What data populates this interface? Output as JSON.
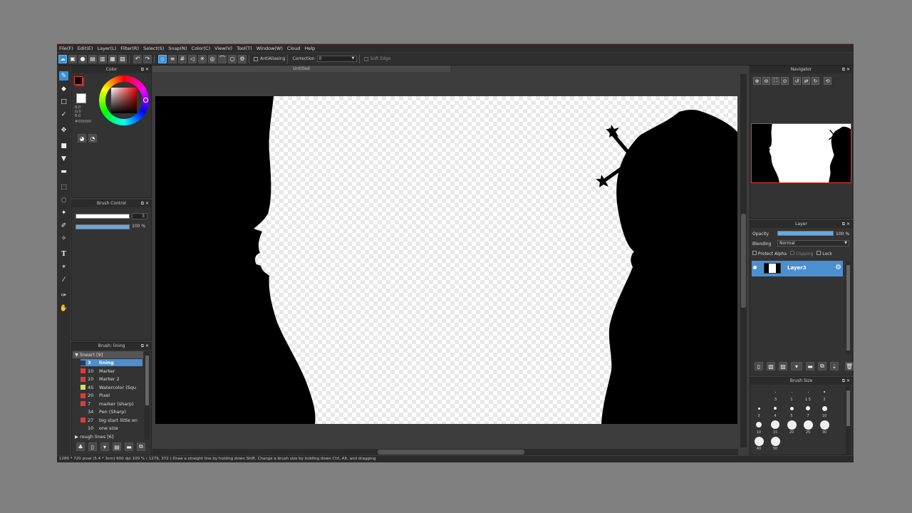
{
  "menu": [
    "File(F)",
    "Edit(E)",
    "Layer(L)",
    "Filter(R)",
    "Select(S)",
    "Snap(N)",
    "Color(C)",
    "View(V)",
    "Tool(T)",
    "Window(W)",
    "Cloud",
    "Help"
  ],
  "toolbar": {
    "antialiasing": "AntiAliasing",
    "correction_label": "Correction",
    "correction_value": "0",
    "soft_edge": "Soft Edge"
  },
  "color_panel": {
    "title": "Color",
    "r": "R:0",
    "g": "G:0",
    "b": "B:0",
    "hex": "#000000",
    "fg_color": "#000000",
    "bg_color": "#ffffff"
  },
  "brush_control": {
    "title": "Brush Control",
    "size": "3",
    "opacity": "100 %",
    "opacity_fraction": 1.0
  },
  "brush_panel": {
    "title": "Brush: lining",
    "group_open": "lineart [9]",
    "items": [
      {
        "size": "3",
        "name": "lining",
        "color": "#2b3a55",
        "selected": true
      },
      {
        "size": "10",
        "name": "Marker",
        "color": "#e53935"
      },
      {
        "size": "10",
        "name": "Marker 2",
        "color": "#e53935"
      },
      {
        "size": "45",
        "name": "Watercolor (Squ",
        "color": "#d4e157"
      },
      {
        "size": "20",
        "name": "Pixel",
        "color": "#e53935"
      },
      {
        "size": "7",
        "name": "marker (sharp)",
        "color": "#e53935"
      },
      {
        "size": "34",
        "name": "Pen (Sharp)",
        "color": "#333333"
      },
      {
        "size": "27",
        "name": "big start little en",
        "color": "#e53935"
      },
      {
        "size": "10",
        "name": "one size",
        "color": "#333333"
      }
    ],
    "group_closed": "rough lines [6]"
  },
  "document": {
    "tab_title": "Untitled"
  },
  "navigator": {
    "title": "Navigator"
  },
  "layer_panel": {
    "title": "Layer",
    "opacity_label": "Opacity",
    "opacity_value": "100 %",
    "opacity_fraction": 1.0,
    "blending_label": "Blending",
    "blending_value": "Normal",
    "protect_alpha": "Protect Alpha",
    "clipping": "Clipping",
    "lock": "Lock",
    "layer_name": "Layer3"
  },
  "brush_size": {
    "title": "Brush Size",
    "labels": [
      ".5",
      "1",
      "1.5",
      "2",
      "3",
      "4",
      "5",
      "7",
      "10",
      "10",
      "15",
      "20",
      "25",
      "30",
      "40",
      "50"
    ]
  },
  "status": "1280 * 720 pixel  (5.4 * 3cm)  600 dpi  109 %  ( 1279, 372 )  Draw a straight line by holding down Shift, Change a brush size by holding down Ctrl, Alt, and dragging"
}
